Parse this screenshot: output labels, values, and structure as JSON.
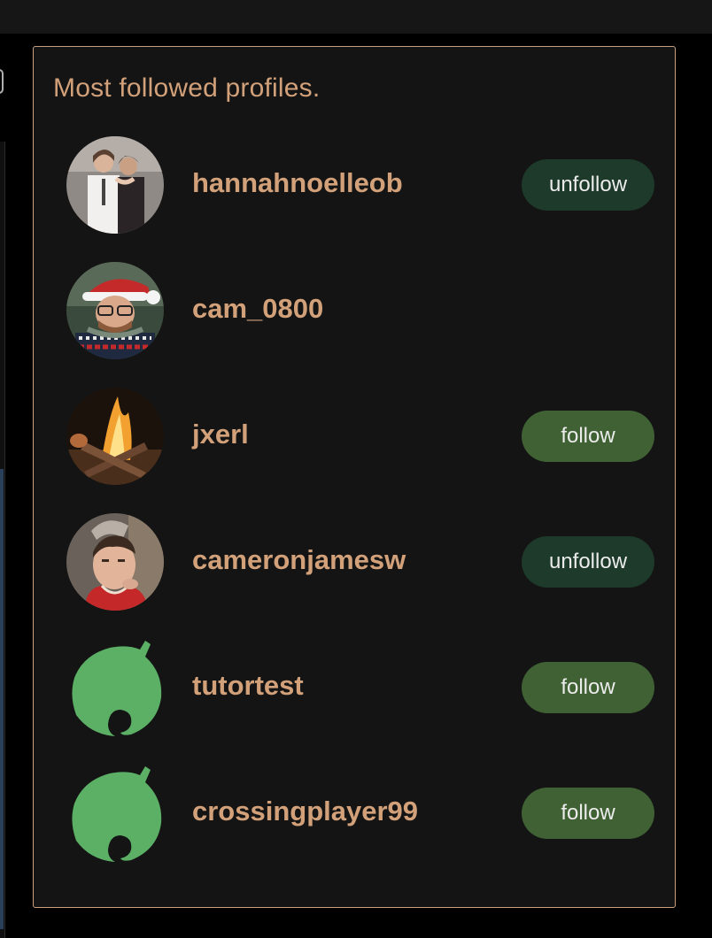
{
  "panel": {
    "title": "Most followed profiles.",
    "accent_color": "#d2a17a",
    "border_color": "#c9a07e"
  },
  "profiles": [
    {
      "username": "hannahnoelleob",
      "avatar": "photo-couple",
      "action": "unfollow"
    },
    {
      "username": "cam_0800",
      "avatar": "photo-santa-hat",
      "action": ""
    },
    {
      "username": "jxerl",
      "avatar": "photo-campfire",
      "action": "follow"
    },
    {
      "username": "cameronjamesw",
      "avatar": "photo-selfie",
      "action": "unfollow"
    },
    {
      "username": "tutortest",
      "avatar": "leaf-icon",
      "action": "follow"
    },
    {
      "username": "crossingplayer99",
      "avatar": "leaf-icon",
      "action": "follow"
    }
  ],
  "colors": {
    "follow_button": "#3f6133",
    "unfollow_button": "#1d3a2a",
    "leaf_green": "#5bb066"
  }
}
